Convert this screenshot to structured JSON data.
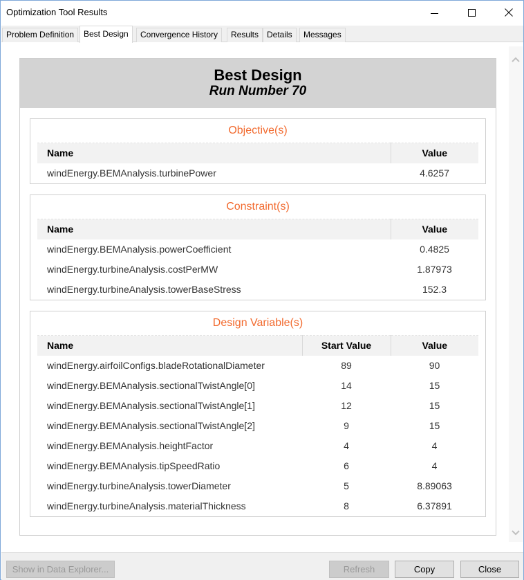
{
  "window": {
    "title": "Optimization Tool Results",
    "controls": {
      "minimize": "minimize-icon",
      "maximize": "maximize-icon",
      "close": "close-icon"
    }
  },
  "tabs": [
    {
      "label": "Problem Definition",
      "active": false
    },
    {
      "label": "Best Design",
      "active": true
    },
    {
      "label": "Convergence History",
      "active": false
    },
    {
      "label": "Results",
      "active": false
    },
    {
      "label": "Details",
      "active": false
    },
    {
      "label": "Messages",
      "active": false
    }
  ],
  "report": {
    "title": "Best Design",
    "subtitle": "Run Number 70",
    "accent_color": "#f26a2e",
    "objectives": {
      "title": "Objective(s)",
      "columns": [
        "Name",
        "Value"
      ],
      "rows": [
        {
          "name": "windEnergy.BEMAnalysis.turbinePower",
          "value": "4.6257"
        }
      ]
    },
    "constraints": {
      "title": "Constraint(s)",
      "columns": [
        "Name",
        "Value"
      ],
      "rows": [
        {
          "name": "windEnergy.BEMAnalysis.powerCoefficient",
          "value": "0.4825"
        },
        {
          "name": "windEnergy.turbineAnalysis.costPerMW",
          "value": "1.87973"
        },
        {
          "name": "windEnergy.turbineAnalysis.towerBaseStress",
          "value": "152.3"
        }
      ]
    },
    "design_variables": {
      "title": "Design Variable(s)",
      "columns": [
        "Name",
        "Start Value",
        "Value"
      ],
      "rows": [
        {
          "name": "windEnergy.airfoilConfigs.bladeRotationalDiameter",
          "start": "89",
          "value": "90"
        },
        {
          "name": "windEnergy.BEMAnalysis.sectionalTwistAngle[0]",
          "start": "14",
          "value": "15"
        },
        {
          "name": "windEnergy.BEMAnalysis.sectionalTwistAngle[1]",
          "start": "12",
          "value": "15"
        },
        {
          "name": "windEnergy.BEMAnalysis.sectionalTwistAngle[2]",
          "start": "9",
          "value": "15"
        },
        {
          "name": "windEnergy.BEMAnalysis.heightFactor",
          "start": "4",
          "value": "4"
        },
        {
          "name": "windEnergy.BEMAnalysis.tipSpeedRatio",
          "start": "6",
          "value": "4"
        },
        {
          "name": "windEnergy.turbineAnalysis.towerDiameter",
          "start": "5",
          "value": "8.89063"
        },
        {
          "name": "windEnergy.turbineAnalysis.materialThickness",
          "start": "8",
          "value": "6.37891"
        }
      ]
    }
  },
  "footer": {
    "show_in_data_explorer": {
      "label": "Show in Data Explorer...",
      "enabled": false
    },
    "refresh": {
      "label": "Refresh",
      "enabled": false
    },
    "copy": {
      "label": "Copy",
      "enabled": true
    },
    "close": {
      "label": "Close",
      "enabled": true
    }
  }
}
